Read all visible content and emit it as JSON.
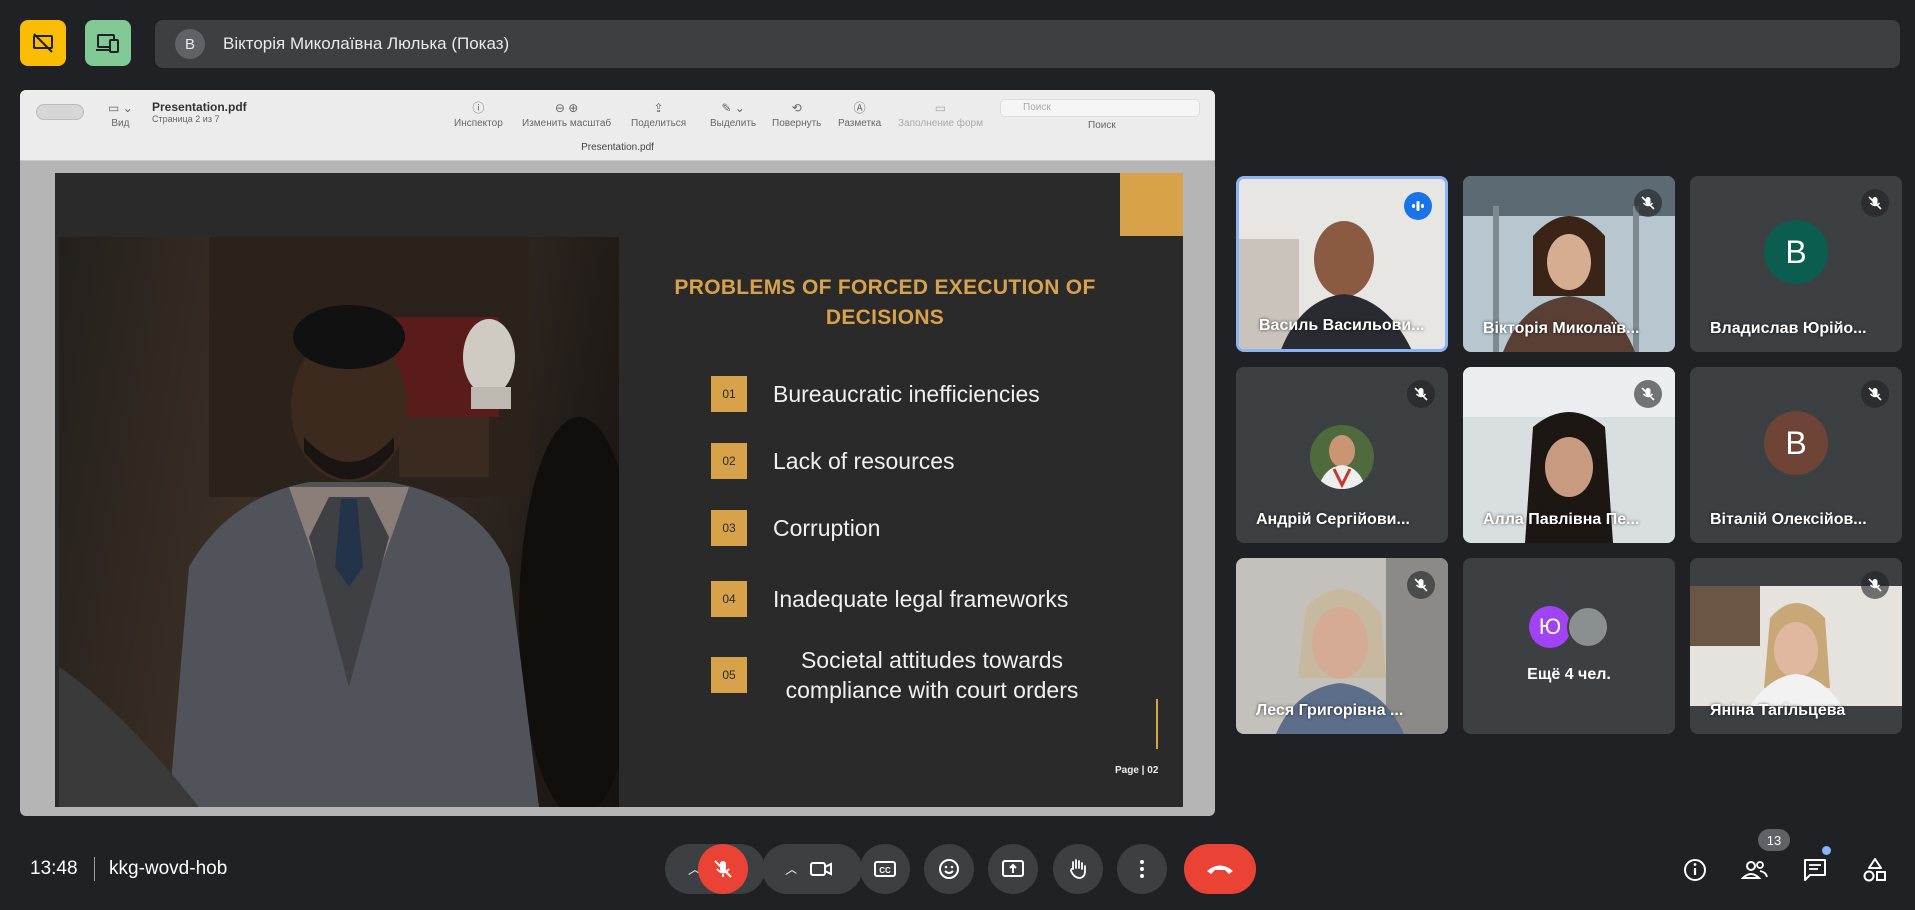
{
  "top": {
    "presenter_initial": "В",
    "presenter_name": "Вікторія Миколаївна Люлька (Показ)"
  },
  "pdf_viewer": {
    "title": "Presentation.pdf",
    "page_info": "Страница 2 из 7",
    "center_title": "Presentation.pdf",
    "search_placeholder": "Поиск",
    "toolbar": {
      "view": "Вид",
      "inspector": "Инспектор",
      "zoom": "Изменить масштаб",
      "share": "Поделиться",
      "highlight": "Выделить",
      "rotate": "Повернуть",
      "markup": "Разметка",
      "forms": "Заполнение форм",
      "search": "Поиск"
    }
  },
  "slide": {
    "heading": "PROBLEMS OF FORCED EXECUTION OF DECISIONS",
    "items": [
      {
        "num": "01",
        "text": "Bureaucratic inefficiencies"
      },
      {
        "num": "02",
        "text": " Lack of resources"
      },
      {
        "num": "03",
        "text": "Corruption"
      },
      {
        "num": "04",
        "text": "Inadequate legal frameworks"
      },
      {
        "num": "05",
        "text": "Societal attitudes towards compliance with court orders"
      }
    ],
    "footer": "Page | 02",
    "accent_color": "#d8a24a"
  },
  "participants": [
    {
      "name": "Василь Васильови...",
      "kind": "video",
      "speaking": true
    },
    {
      "name": "Вікторія Миколаїв...",
      "kind": "video",
      "muted": true
    },
    {
      "name": "Владислав Юрійо...",
      "kind": "letter",
      "initial": "В",
      "color": "#0b5e4f",
      "muted": true
    },
    {
      "name": "Андрій Сергійови...",
      "kind": "photo",
      "muted": true
    },
    {
      "name": "Алла Павлівна Пе...",
      "kind": "video",
      "muted": true
    },
    {
      "name": "Віталій Олексійов...",
      "kind": "letter",
      "initial": "В",
      "color": "#6d4436",
      "muted": true
    },
    {
      "name": "Леся Григорівна ...",
      "kind": "video",
      "muted": true
    },
    {
      "more_label": "Ещё 4 чел.",
      "initial": "Ю",
      "kind": "more"
    },
    {
      "name": "Яніна Тагільцева",
      "kind": "video",
      "muted": true
    }
  ],
  "bottom": {
    "time": "13:48",
    "meeting_code": "kkg-wovd-hob",
    "participant_count": "13"
  },
  "colors": {
    "background": "#202124",
    "tile": "#3c4043",
    "danger": "#ea4335",
    "active_border": "#8ab4f8"
  }
}
